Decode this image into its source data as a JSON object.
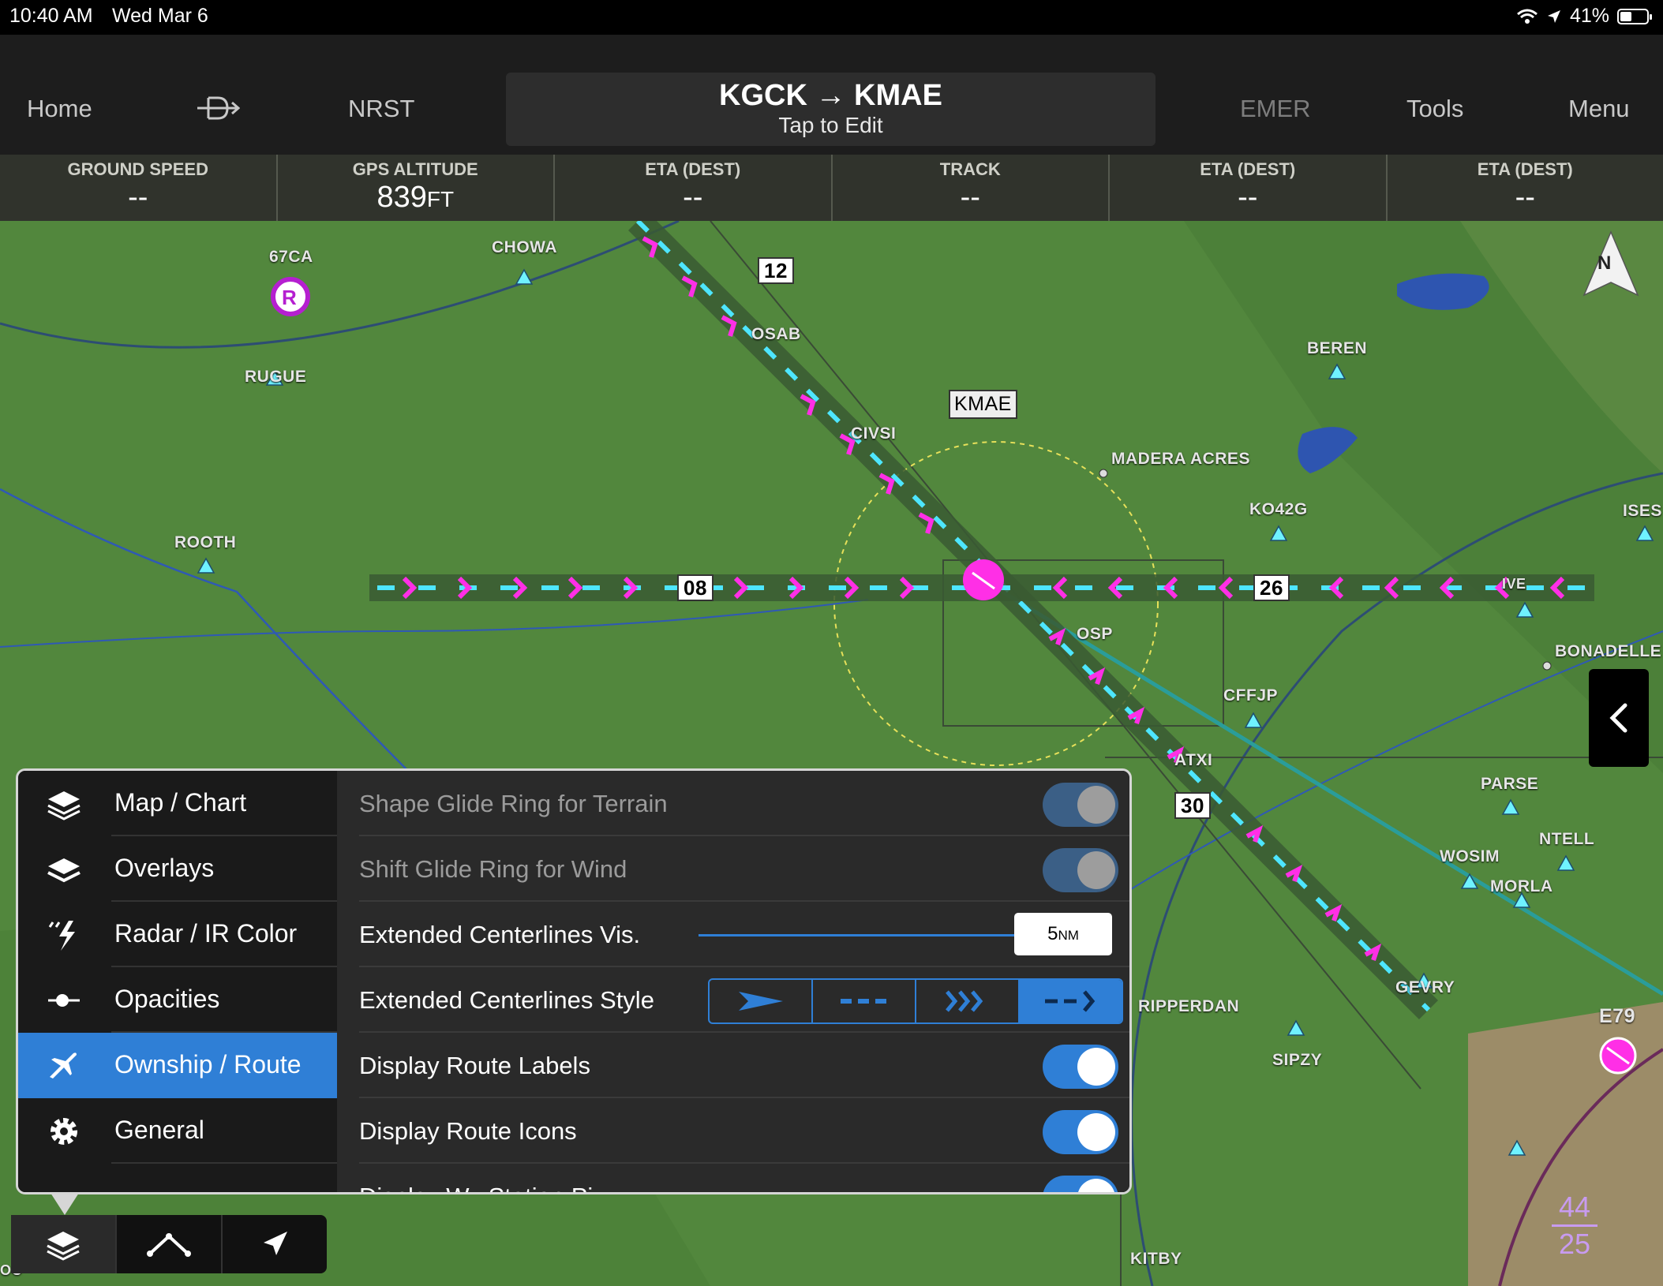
{
  "status_bar": {
    "time": "10:40 AM",
    "date": "Wed Mar 6",
    "battery": "41%"
  },
  "nav": {
    "home": "Home",
    "direct_to": "-D->",
    "nrst": "NRST",
    "route": "KGCK → KMAE",
    "route_sub": "Tap to Edit",
    "emer": "EMER",
    "tools": "Tools",
    "menu": "Menu"
  },
  "data_strip": [
    {
      "label": "GROUND SPEED",
      "value": "--",
      "unit": ""
    },
    {
      "label": "GPS ALTITUDE",
      "value": "839",
      "unit": "FT"
    },
    {
      "label": "ETA (DEST)",
      "value": "--",
      "unit": ""
    },
    {
      "label": "TRACK",
      "value": "--",
      "unit": ""
    },
    {
      "label": "ETA (DEST)",
      "value": "--",
      "unit": ""
    },
    {
      "label": "ETA (DEST)",
      "value": "--",
      "unit": ""
    }
  ],
  "map": {
    "north": "N",
    "airport": "KMAE",
    "runway_labels": [
      "08",
      "26",
      "12",
      "30"
    ],
    "restricted_symbol": "R",
    "wx_top": "44",
    "wx_bottom": "25",
    "labels": {
      "l67ca": "67CA",
      "chowa": "CHOWA",
      "rugue": "RUGUE",
      "rooth": "ROOTH",
      "osab": "OSAB",
      "civsi": "CIVSI",
      "madera": "MADERA ACRES",
      "beren": "BEREN",
      "ko42g": "KO42G",
      "ises": "ISES",
      "bonadelle": "BONADELLE",
      "cffjp": "CFFJP",
      "osp": "OSP",
      "atxi": "ATXI",
      "parse": "PARSE",
      "ntell": "NTELL",
      "wosim": "WOSIM",
      "morla": "MORLA",
      "gevry": "GEVRY",
      "ripperdan": "RIPPERDAN",
      "sipzy": "SIPZY",
      "e79": "E79",
      "kitby": "KITBY",
      "ive": "IVE",
      "oo": "OO"
    }
  },
  "categories": [
    {
      "label": "Map / Chart",
      "icon": "layers-icon"
    },
    {
      "label": "Overlays",
      "icon": "overlays-icon"
    },
    {
      "label": "Radar / IR Color",
      "icon": "radar-icon"
    },
    {
      "label": "Opacities",
      "icon": "opacity-slider-icon"
    },
    {
      "label": "Ownship / Route",
      "icon": "airplane-icon"
    },
    {
      "label": "General",
      "icon": "gear-icon"
    }
  ],
  "selected_category": "Ownship / Route",
  "settings": {
    "shape_glide": {
      "label": "Shape Glide Ring for Terrain",
      "on": true,
      "enabled": false
    },
    "shift_glide": {
      "label": "Shift Glide Ring for Wind",
      "on": true,
      "enabled": false
    },
    "centerline_vis": {
      "label": "Extended Centerlines Vis.",
      "value": "5",
      "unit": "NM"
    },
    "centerline_style": {
      "label": "Extended Centerlines Style",
      "options": [
        "arrow",
        "dashes",
        "chevrons",
        "dash-chevron"
      ],
      "selected": "dash-chevron"
    },
    "route_labels": {
      "label": "Display Route Labels",
      "on": true
    },
    "route_icons": {
      "label": "Display Route Icons",
      "on": true
    },
    "wx_station": {
      "label": "Display Wx Station Pi...",
      "on": true
    }
  },
  "toolbar": [
    "layers-icon",
    "route-icon",
    "ownship-arrow-icon"
  ],
  "colors": {
    "accent": "#2f7fd6",
    "centerline": "#ff2fe6",
    "centerline_dash": "#4ee6ff",
    "map_green": "#52873d"
  }
}
